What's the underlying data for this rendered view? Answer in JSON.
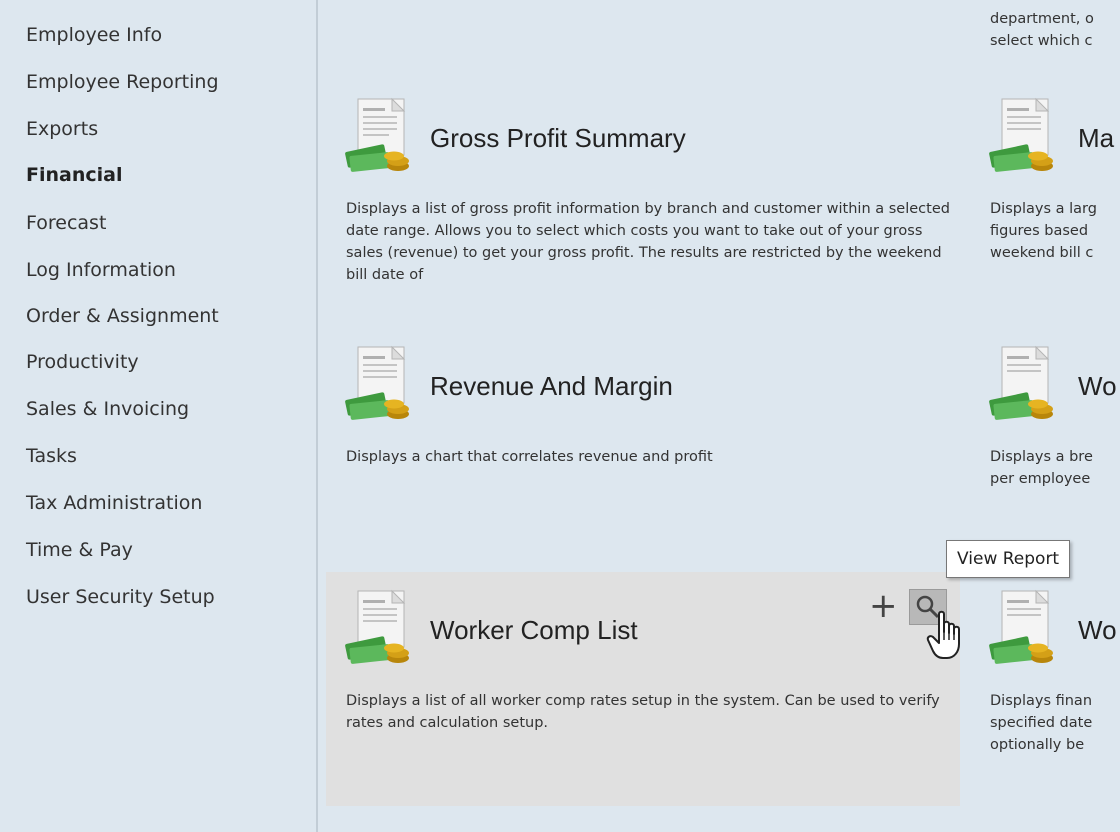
{
  "sidebar": {
    "items": [
      {
        "label": "Employee Info"
      },
      {
        "label": "Employee Reporting"
      },
      {
        "label": "Exports"
      },
      {
        "label": "Financial",
        "active": true
      },
      {
        "label": "Forecast"
      },
      {
        "label": "Log Information"
      },
      {
        "label": "Order & Assignment"
      },
      {
        "label": "Productivity"
      },
      {
        "label": "Sales & Invoicing"
      },
      {
        "label": "Tasks"
      },
      {
        "label": "Tax Administration"
      },
      {
        "label": "Time & Pay"
      },
      {
        "label": "User Security Setup"
      }
    ]
  },
  "reports": {
    "top_right_partial": [
      "department, o",
      "select which c"
    ],
    "gross_profit": {
      "title": "Gross Profit Summary",
      "desc": "Displays a list of gross profit information by branch and customer within a selected date range.  Allows you to select which costs you want to take out of your gross sales (revenue) to get your gross profit.  The results are restricted by the weekend bill date of"
    },
    "margin_partial": {
      "title": "Ma",
      "desc_lines": [
        "Displays a larg",
        "figures based",
        "weekend bill c"
      ]
    },
    "revenue_margin": {
      "title": "Revenue And Margin",
      "desc": "Displays a chart that correlates revenue and profit"
    },
    "wo_partial_1": {
      "title": "Wo",
      "desc_lines": [
        "Displays a bre",
        "per employee"
      ]
    },
    "worker_comp": {
      "title": "Worker Comp List",
      "desc": "Displays a list of all worker comp rates setup in the system.  Can be used to verify rates and calculation setup.",
      "add_label": "+"
    },
    "wo_partial_2": {
      "title": "Wo",
      "desc_lines": [
        "Displays finan",
        "specified date",
        "optionally be"
      ]
    }
  },
  "tooltip": {
    "text": "View Report"
  },
  "icons": {
    "report": "report-document-money-icon",
    "view": "magnifier-icon",
    "add": "plus-icon",
    "cursor": "hand-pointer-cursor-icon"
  }
}
